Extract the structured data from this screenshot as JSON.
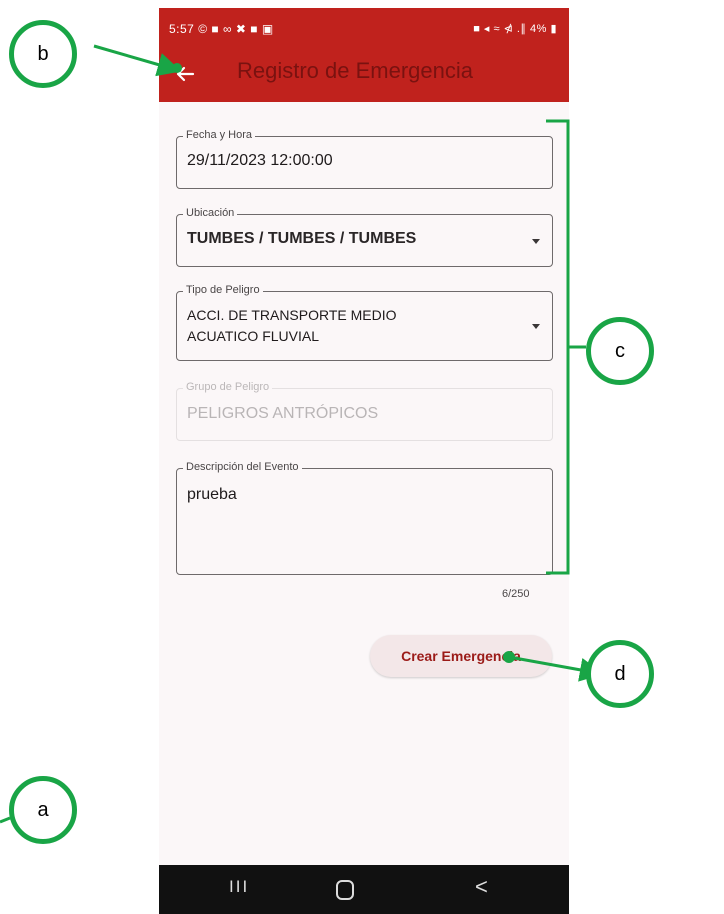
{
  "status_bar": {
    "time": "5:57",
    "left_icons": "© ■ ∞ ✖ ■ ▣",
    "right_icons": "■ ◂ ≈ ⋪ .∥ 4% ▮"
  },
  "app_bar": {
    "title": "Registro de Emergencia",
    "back_icon": "arrow-left-icon"
  },
  "form": {
    "datetime": {
      "label": "Fecha y Hora",
      "value": "29/11/2023 12:00:00"
    },
    "location": {
      "label": "Ubicación",
      "value": "TUMBES / TUMBES / TUMBES"
    },
    "hazard_type": {
      "label": "Tipo de Peligro",
      "value_line1": "ACCI. DE TRANSPORTE MEDIO",
      "value_line2": "ACUATICO FLUVIAL"
    },
    "hazard_group": {
      "label": "Grupo de Peligro",
      "value": "PELIGROS ANTRÓPICOS"
    },
    "description": {
      "label": "Descripción del Evento",
      "value": "prueba",
      "counter": "6/250"
    }
  },
  "actions": {
    "create_label": "Crear Emergencia"
  },
  "nav_bar": {
    "recent_icon": "III",
    "home_icon": "home-icon",
    "back_icon": "<"
  },
  "callouts": {
    "a": "a",
    "b": "b",
    "c": "c",
    "d": "d"
  },
  "colors": {
    "accent": "#c0221d",
    "callout": "#19a546",
    "button_text": "#9b1b18"
  }
}
